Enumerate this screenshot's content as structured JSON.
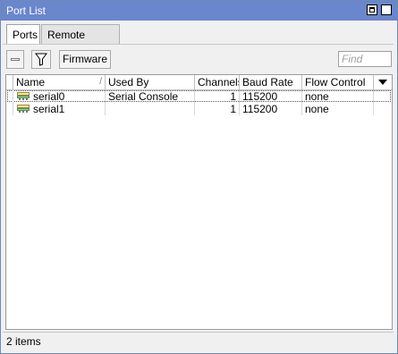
{
  "window": {
    "title": "Port List"
  },
  "tabs": [
    {
      "label": "Ports",
      "active": true
    },
    {
      "label": "Remote Access",
      "active": false
    }
  ],
  "toolbar": {
    "remove_icon": "minus-icon",
    "filter_icon": "filter-icon",
    "firmware_label": "Firmware",
    "find_placeholder": "Find"
  },
  "table": {
    "columns": [
      "Name",
      "Used By",
      "Channels",
      "Baud Rate",
      "Flow Control"
    ],
    "sorted_column": "Name",
    "rows": [
      {
        "name": "serial0",
        "used_by": "Serial Console",
        "channels": "1",
        "baud_rate": "115200",
        "flow_control": "none",
        "icon": "serial-port-icon"
      },
      {
        "name": "serial1",
        "used_by": "",
        "channels": "1",
        "baud_rate": "115200",
        "flow_control": "none",
        "icon": "serial-port-icon"
      }
    ]
  },
  "status": {
    "text": "2 items"
  },
  "colors": {
    "titlebar": "#6a86cc",
    "window_bg": "#f0f0f0"
  }
}
